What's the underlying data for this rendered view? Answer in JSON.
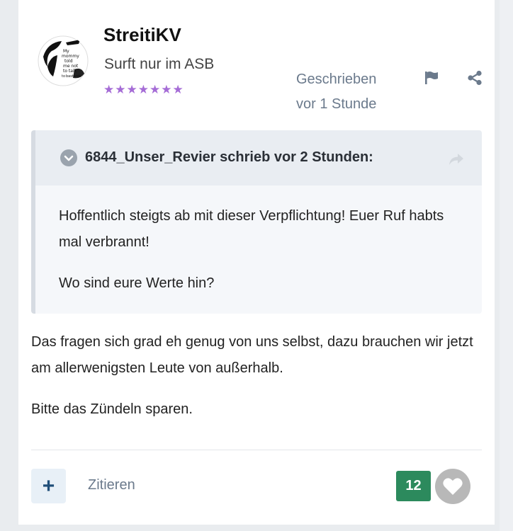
{
  "author": {
    "name": "StreitiKV",
    "title": "Surft nur im ASB",
    "stars": "★★★★★★★",
    "star_color": "#a56cd6",
    "avatar_text": [
      "My",
      "mommy",
      "told",
      "me not",
      "to talk",
      "to",
      "bastards"
    ]
  },
  "meta": {
    "posted_label": "Geschrieben",
    "posted_time": "vor 1 Stunde",
    "flag_icon": "flag-icon",
    "share_icon": "share-icon"
  },
  "quote": {
    "citation": "6844_Unser_Revier schrieb vor 2 Stunden:",
    "paragraphs": [
      "Hoffentlich steigts ab mit dieser Verpflichtung! Euer Ruf habts mal verbrannt!",
      "Wo sind eure Werte hin?"
    ]
  },
  "post": {
    "paragraphs": [
      "Das fragen sich grad eh genug von uns selbst, dazu brauchen wir jetzt am allerwenigsten Leute von außerhalb.",
      "Bitte das Zündeln sparen."
    ]
  },
  "actions": {
    "add_label": "+",
    "quote_label": "Zitieren",
    "like_count": "12",
    "like_color": "#2c8a5d"
  }
}
